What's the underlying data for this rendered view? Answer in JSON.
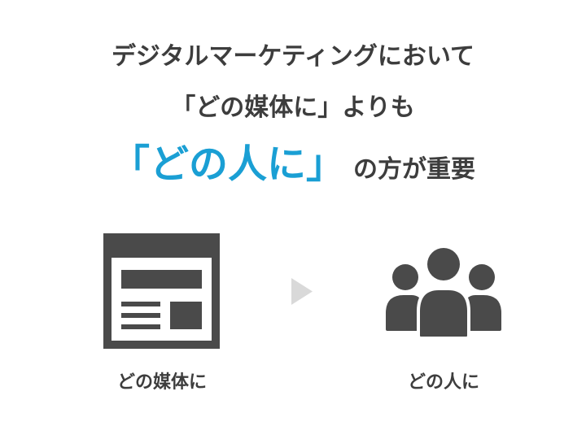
{
  "headline": {
    "line1": "デジタルマーケティングにおいて",
    "line2": "「どの媒体に」よりも",
    "line3_highlight": "「どの人に」",
    "line3_rest": "の方が重要"
  },
  "diagram": {
    "left_caption": "どの媒体に",
    "right_caption": "どの人に",
    "left_icon": "webpage-media-icon",
    "arrow_icon": "triangle-right-icon",
    "right_icon": "people-group-icon"
  },
  "colors": {
    "text": "#3d3d3d",
    "highlight": "#1a9fd4",
    "icon": "#4a4a4a",
    "arrow": "#d9d9d9"
  }
}
